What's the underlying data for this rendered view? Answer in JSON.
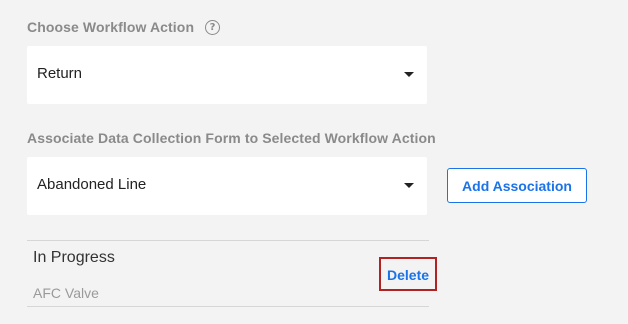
{
  "workflow_action": {
    "label": "Choose Workflow Action",
    "help_icon": "question-mark-circle",
    "help_glyph": "?",
    "selected_value": "Return"
  },
  "data_collection": {
    "label": "Associate Data Collection Form to Selected Workflow Action",
    "selected_value": "Abandoned Line",
    "add_button_label": "Add Association"
  },
  "associations": [
    {
      "title": "In Progress",
      "subtitle": "AFC Valve",
      "delete_label": "Delete"
    }
  ],
  "colors": {
    "accent": "#1a73e8",
    "highlight_border": "#b22222",
    "background": "#f3f3f3"
  }
}
